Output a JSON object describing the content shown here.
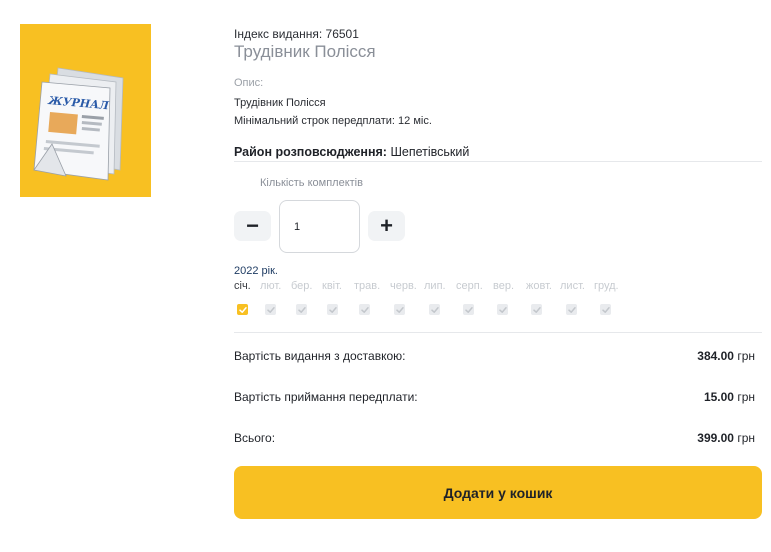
{
  "product": {
    "index_line": "Індекс видання: 76501",
    "title": "Трудівник Полісся",
    "description_label": "Опис:",
    "description_lines": [
      "Трудівник Полісся",
      "Мінімальний строк передплати: 12 міс."
    ],
    "district_label": "Район розповсюдження:",
    "district_value": "Шепетівський",
    "cover_text": "ЖУРНАЛ",
    "cover_color": "#f8c022"
  },
  "quantity": {
    "label": "Кількість комплектів",
    "minus": "−",
    "plus": "+",
    "value": "1"
  },
  "subscription": {
    "year": "2022 рік.",
    "months": [
      {
        "label": "січ.",
        "checked": true
      },
      {
        "label": "лют.",
        "checked": false
      },
      {
        "label": "бер.",
        "checked": false
      },
      {
        "label": "квіт.",
        "checked": false
      },
      {
        "label": "трав.",
        "checked": false
      },
      {
        "label": "черв.",
        "checked": false
      },
      {
        "label": "лип.",
        "checked": false
      },
      {
        "label": "серп.",
        "checked": false
      },
      {
        "label": "вер.",
        "checked": false
      },
      {
        "label": "жовт.",
        "checked": false
      },
      {
        "label": "лист.",
        "checked": false
      },
      {
        "label": "груд.",
        "checked": false
      }
    ]
  },
  "pricing": {
    "delivery_label": "Вартість видання з доставкою:",
    "delivery_value": "384.00",
    "fee_label": "Вартість приймання передплати:",
    "fee_value": "15.00",
    "total_label": "Всього:",
    "total_value": "399.00",
    "currency": "грн"
  },
  "cart_button": "Додати у кошик",
  "colors": {
    "accent": "#f8c022",
    "text": "#1f2228",
    "muted": "#8a8f98"
  }
}
